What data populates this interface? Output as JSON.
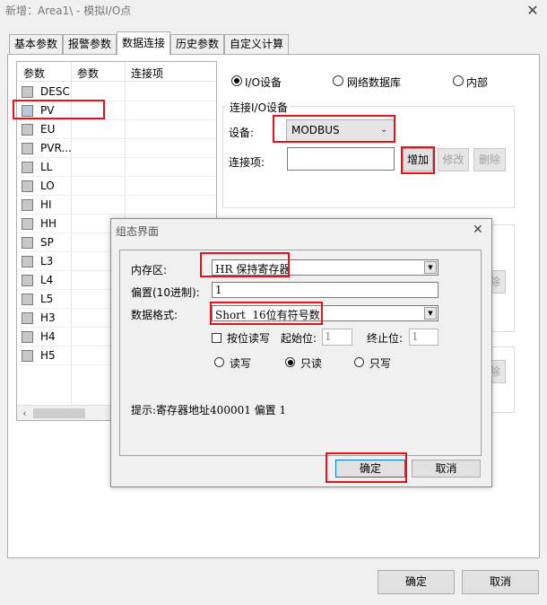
{
  "window": {
    "title": "新增：Area1\\ - 模拟I/O点",
    "close_glyph": "✕"
  },
  "tabs": [
    {
      "label": "基本参数"
    },
    {
      "label": "报警参数"
    },
    {
      "label": "数据连接",
      "active": true
    },
    {
      "label": "历史参数"
    },
    {
      "label": "自定义计算"
    }
  ],
  "list": {
    "headers": [
      "参数",
      "参数",
      "连接项"
    ],
    "rows": [
      "DESC",
      "PV",
      "EU",
      "PVR...",
      "LL",
      "LO",
      "HI",
      "HH",
      "SP",
      "L3",
      "L4",
      "L5",
      "H3",
      "H4",
      "H5"
    ],
    "scroll_left": "‹",
    "scroll_right": "›"
  },
  "source_options": {
    "io": "I/O设备",
    "network": "网络数据库",
    "internal": "内部",
    "selected": "I/O设备"
  },
  "connect_io": {
    "group_title": "连接I/O设备",
    "device_label": "设备:",
    "device_value": "MODBUS",
    "item_label": "连接项:",
    "item_value": "",
    "add_button": "增加",
    "edit_button": "修改",
    "delete_button": "删除"
  },
  "hidden_buttons": {
    "label": "除"
  },
  "dialog": {
    "title": "组态界面",
    "close_glyph": "✕",
    "memory_label": "内存区:",
    "memory_value": "HR 保持寄存器",
    "offset_label": "偏置(10进制):",
    "offset_value": "1",
    "format_label": "数据格式:",
    "format_value": "Short  16位有符号数",
    "bit_read_label": "按位读写",
    "start_bit_label": "起始位:",
    "start_bit_value": "1",
    "end_bit_label": "终止位:",
    "end_bit_value": "1",
    "modes": [
      "读写",
      "只读",
      "只写"
    ],
    "mode_selected": "只读",
    "hint": "提示:寄存器地址400001 偏置 1",
    "ok_button": "确定",
    "cancel_button": "取消"
  },
  "footer": {
    "ok_button": "确定",
    "cancel_button": "取消"
  },
  "colors": {
    "highlight": "#e8101a",
    "focus": "#0078d7"
  }
}
